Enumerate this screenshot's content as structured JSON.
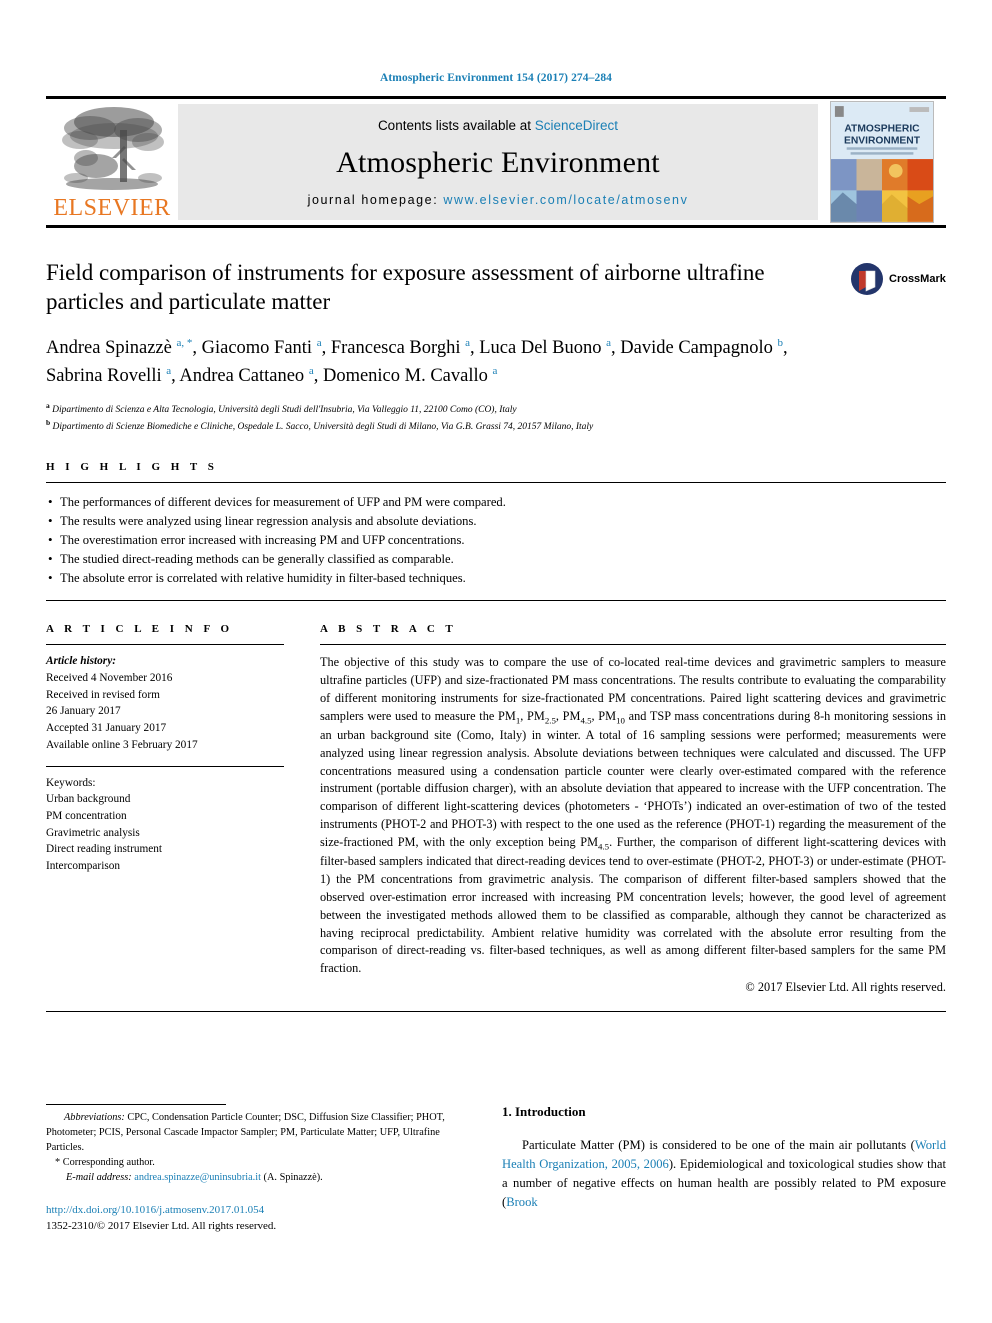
{
  "running_head": "Atmospheric Environment 154 (2017) 274–284",
  "masthead": {
    "contents_prefix": "Contents lists available at ",
    "contents_link": "ScienceDirect",
    "journal_name": "Atmospheric Environment",
    "homepage_prefix": "journal homepage: ",
    "homepage_url": "www.elsevier.com/locate/atmosenv",
    "publisher": "ELSEVIER",
    "cover_title_line1": "ATMOSPHERIC",
    "cover_title_line2": "ENVIRONMENT"
  },
  "article": {
    "title": "Field comparison of instruments for exposure assessment of airborne ultrafine particles and particulate matter",
    "crossmark_label": "CrossMark",
    "authors": [
      {
        "name": "Andrea Spinazzè",
        "marks": "a, *"
      },
      {
        "name": "Giacomo Fanti",
        "marks": "a"
      },
      {
        "name": "Francesca Borghi",
        "marks": "a"
      },
      {
        "name": "Luca Del Buono",
        "marks": "a"
      },
      {
        "name": "Davide Campagnolo",
        "marks": "b"
      },
      {
        "name": "Sabrina Rovelli",
        "marks": "a"
      },
      {
        "name": "Andrea Cattaneo",
        "marks": "a"
      },
      {
        "name": "Domenico M. Cavallo",
        "marks": "a"
      }
    ],
    "affiliations": [
      {
        "mark": "a",
        "text": "Dipartimento di Scienza e Alta Tecnologia, Università degli Studi dell'Insubria, Via Valleggio 11, 22100 Como (CO), Italy"
      },
      {
        "mark": "b",
        "text": "Dipartimento di Scienze Biomediche e Cliniche, Ospedale L. Sacco, Università degli Studi di Milano, Via G.B. Grassi 74, 20157 Milano, Italy"
      }
    ]
  },
  "highlights": {
    "heading": "H I G H L I G H T S",
    "items": [
      "The performances of different devices for measurement of UFP and PM were compared.",
      "The results were analyzed using linear regression analysis and absolute deviations.",
      "The overestimation error increased with increasing PM and UFP concentrations.",
      "The studied direct-reading methods can be generally classified as comparable.",
      "The absolute error is correlated with relative humidity in filter-based techniques."
    ]
  },
  "article_info": {
    "heading": "A R T I C L E   I N F O",
    "history_label": "Article history:",
    "history": [
      "Received 4 November 2016",
      "Received in revised form",
      "26 January 2017",
      "Accepted 31 January 2017",
      "Available online 3 February 2017"
    ],
    "keywords_label": "Keywords:",
    "keywords": [
      "Urban background",
      "PM concentration",
      "Gravimetric analysis",
      "Direct reading instrument",
      "Intercomparison"
    ]
  },
  "abstract": {
    "heading": "A B S T R A C T",
    "paragraph_part1": "The objective of this study was to compare the use of co-located real-time devices and gravimetric samplers to measure ultrafine particles (UFP) and size-fractionated PM mass concentrations. The results contribute to evaluating the comparability of different monitoring instruments for size-fractionated PM concentrations. Paired light scattering devices and gravimetric samplers were used to measure the PM",
    "sub1": "1",
    "paragraph_part2": ", PM",
    "sub2": "2.5",
    "paragraph_part3": ", PM",
    "sub3": "4.5",
    "paragraph_part4": ", PM",
    "sub4": "10",
    "paragraph_part5": " and TSP mass concentrations during 8-h monitoring sessions in an urban background site (Como, Italy) in winter. A total of 16 sampling sessions were performed; measurements were analyzed using linear regression analysis. Absolute deviations between techniques were calculated and discussed. The UFP concentrations measured using a condensation particle counter were clearly over-estimated compared with the reference instrument (portable diffusion charger), with an absolute deviation that appeared to increase with the UFP concentration. The comparison of different light-scattering devices (photometers - ‘PHOTs’) indicated an over-estimation of two of the tested instruments (PHOT-2 and PHOT-3) with respect to the one used as the reference (PHOT-1) regarding the measurement of the size-fractioned PM, with the only exception being PM",
    "sub5": "4.5",
    "paragraph_part6": ". Further, the comparison of different light-scattering devices with filter-based samplers indicated that direct-reading devices tend to over-estimate (PHOT-2, PHOT-3) or under-estimate (PHOT-1) the PM concentrations from gravimetric analysis. The comparison of different filter-based samplers showed that the observed over-estimation error increased with increasing PM concentration levels; however, the good level of agreement between the investigated methods allowed them to be classified as comparable, although they cannot be characterized as having reciprocal predictability. Ambient relative humidity was correlated with the absolute error resulting from the comparison of direct-reading vs. filter-based techniques, as well as among different filter-based samplers for the same PM fraction.",
    "copyright": "© 2017 Elsevier Ltd. All rights reserved."
  },
  "footnotes": {
    "abbrev_label": "Abbreviations:",
    "abbrev_text": " CPC, Condensation Particle Counter; DSC, Diffusion Size Classifier; PHOT, Photometer; PCIS, Personal Cascade Impactor Sampler; PM, Particulate Matter; UFP, Ultrafine Particles.",
    "corresponding": "Corresponding author.",
    "email_label": "E-mail address:",
    "email": "andrea.spinazze@uninsubria.it",
    "email_suffix": " (A. Spinazzè).",
    "doi": "http://dx.doi.org/10.1016/j.atmosenv.2017.01.054",
    "issn_line": "1352-2310/© 2017 Elsevier Ltd. All rights reserved."
  },
  "introduction": {
    "number_title": "1. Introduction",
    "part1": "Particulate Matter (PM) is considered to be one of the main air pollutants (",
    "cite1": "World Health Organization, 2005, 2006",
    "part2": "). Epidemiological and toxicological studies show that a number of negative effects on human health are possibly related to PM exposure (",
    "cite2": "Brook"
  },
  "colors": {
    "link_blue": "#1a7fb5",
    "elsevier_orange": "#E87722",
    "crossmark_blue": "#23356b",
    "crossmark_red": "#c0392b"
  }
}
